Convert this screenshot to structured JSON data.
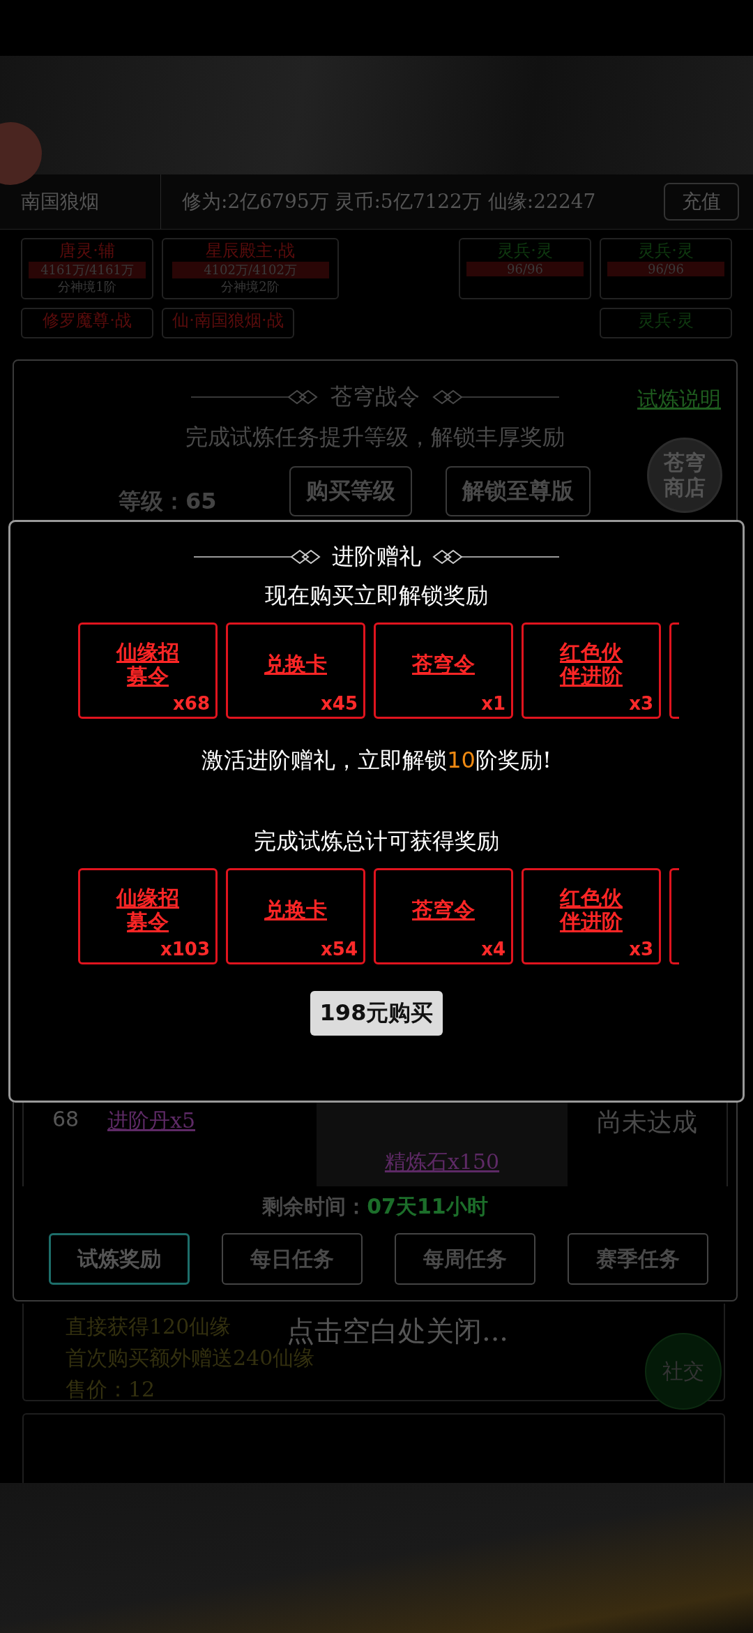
{
  "header": {
    "player_name": "南国狼烟",
    "stats": "修为:2亿6795万 灵币:5亿7122万 仙缘:22247",
    "recharge_button": "充值"
  },
  "team_row_1": [
    {
      "name": "唐灵·辅",
      "hp": "4161万/4161万",
      "realm": "分神境1阶",
      "kind": "hero"
    },
    {
      "name": "星辰殿主·战",
      "hp": "4102万/4102万",
      "realm": "分神境2阶",
      "kind": "hero"
    },
    {
      "name": "灵兵·灵",
      "hp": "96/96",
      "kind": "weapon"
    },
    {
      "name": "灵兵·灵",
      "hp": "96/96",
      "kind": "weapon"
    }
  ],
  "team_row_2": [
    {
      "name": "修罗魔尊·战",
      "kind": "hero"
    },
    {
      "name": "仙·南国狼烟·战",
      "kind": "hero"
    },
    {
      "name": "灵兵·灵",
      "kind": "weapon"
    }
  ],
  "battle_pass": {
    "title": "苍穹战令",
    "help_link": "试炼说明",
    "subtitle": "完成试炼任务提升等级，解锁丰厚奖励",
    "level_label": "等级：65",
    "buy_level_button": "购买等级",
    "unlock_button": "解锁至尊版",
    "shop_button": "苍穹商店",
    "visible_row": {
      "rank": "68",
      "elite_reward": "进阶丹x5",
      "premium_reward": "精炼石x150",
      "status": "尚未达成"
    },
    "time_label": "剩余时间：",
    "time_value": "07天11小时",
    "tabs": [
      {
        "label": "试炼奖励",
        "selected": true
      },
      {
        "label": "每日任务",
        "selected": false
      },
      {
        "label": "每周任务",
        "selected": false
      },
      {
        "label": "赛季任务",
        "selected": false
      }
    ]
  },
  "gift_popup": {
    "title": "进阶赠礼",
    "buy_now_note": "现在购买立即解锁奖励",
    "instant_rewards": [
      {
        "name": "仙缘招募令",
        "count": "x68"
      },
      {
        "name": "兑换卡",
        "count": "x45"
      },
      {
        "name": "苍穹令",
        "count": "x1"
      },
      {
        "name": "红色伙伴进阶",
        "count": "x3"
      }
    ],
    "unlock_note": {
      "before": "激活进阶赠礼，立即解锁",
      "highlight": "10",
      "after": "阶奖励!"
    },
    "total_note": "完成试炼总计可获得奖励",
    "total_rewards": [
      {
        "name": "仙缘招募令",
        "count": "x103"
      },
      {
        "name": "兑换卡",
        "count": "x54"
      },
      {
        "name": "苍穹令",
        "count": "x4"
      },
      {
        "name": "红色伙伴进阶",
        "count": "x3"
      }
    ],
    "buy_button": "198元购买"
  },
  "close_hint": "点击空白处关闭...",
  "offer_card": {
    "lines": [
      "直接获得120仙缘",
      "首次购买额外赠送240仙缘",
      "售价：12"
    ],
    "social_button": "社交"
  }
}
